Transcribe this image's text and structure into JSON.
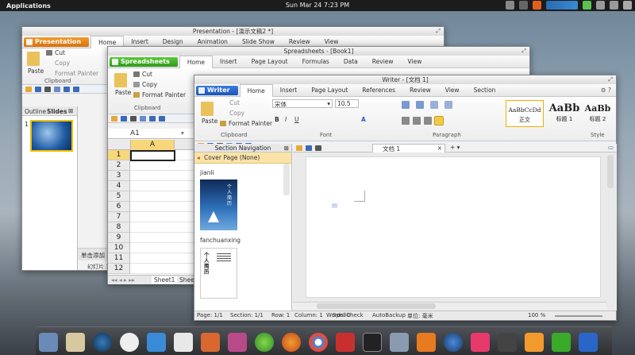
{
  "panel": {
    "applications": "Applications",
    "clock": "Sun Mar 24   7:23 PM"
  },
  "presentation": {
    "title": "Presentation - [演示文稿2 *]",
    "app_label": "Presentation",
    "menus": [
      "Home",
      "Insert",
      "Design",
      "Animation",
      "Slide Show",
      "Review",
      "View"
    ],
    "paste": "Paste",
    "cut": "Cut",
    "copy": "Copy",
    "format_painter": "Format Painter",
    "clipboard": "Clipboard",
    "tab_outline": "Outline",
    "tab_slides": "Slides",
    "slide_number": "1",
    "note_text": "单击添加",
    "status": "幻灯片 1"
  },
  "spreadsheets": {
    "title": "Spreadsheets - [Book1]",
    "app_label": "Spreadsheets",
    "menus": [
      "Home",
      "Insert",
      "Page Layout",
      "Formulas",
      "Data",
      "Review",
      "View"
    ],
    "paste": "Paste",
    "cut": "Cut",
    "copy": "Copy",
    "format_painter": "Format Painter",
    "clipboard": "Clipboard",
    "cell_ref": "A1",
    "col_a": "A",
    "rows": [
      "1",
      "2",
      "3",
      "4",
      "5",
      "6",
      "7",
      "8",
      "9",
      "10",
      "11",
      "12"
    ],
    "sheets": [
      "Sheet1",
      "Shee"
    ]
  },
  "writer": {
    "title": "Writer - [文档 1]",
    "app_label": "Writer",
    "menus": [
      "Home",
      "Insert",
      "Page Layout",
      "References",
      "Review",
      "View",
      "Section"
    ],
    "paste": "Paste",
    "cut": "Cut",
    "copy": "Copy",
    "format_painter": "Format Painter",
    "clipboard": "Clipboard",
    "font_name": "宋体",
    "font_size": "10.5",
    "font_group": "Font",
    "paragraph_group": "Paragraph",
    "style_group": "Style",
    "styles": [
      {
        "sample": "AaBbCcDd",
        "name": "正文"
      },
      {
        "sample": "AaBb",
        "name": "标题 1"
      },
      {
        "sample": "AaBb",
        "name": "标题 2"
      }
    ],
    "section_nav": "Section Navigation",
    "cover_page": "Cover Page (None)",
    "templates": [
      {
        "name": "jianli",
        "thumb_text": "个人简历"
      },
      {
        "name": "fanchuanxing",
        "thumb_text": "个人简历"
      }
    ],
    "doc_tab": "文档 1",
    "status": {
      "page": "Page: 1/1",
      "section": "Section: 1/1",
      "row": "Row: 1",
      "column": "Column: 1",
      "words": "Words: 0",
      "spellcheck": "SpellCheck",
      "autobackup": "AutoBackup",
      "unit": "单位: 毫米",
      "zoom": "100 %"
    }
  }
}
